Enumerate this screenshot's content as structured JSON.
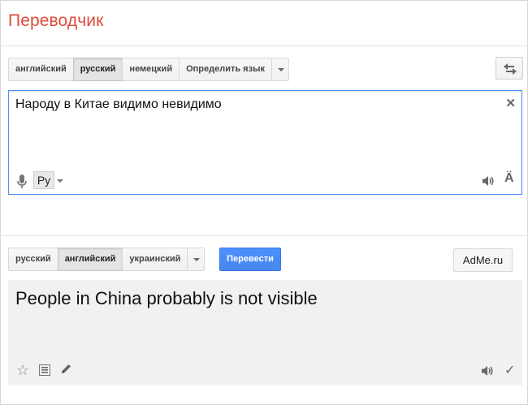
{
  "app": {
    "title": "Переводчик"
  },
  "source": {
    "languages": [
      {
        "label": "английский",
        "active": false
      },
      {
        "label": "русский",
        "active": true
      },
      {
        "label": "немецкий",
        "active": false
      },
      {
        "label": "Определить язык",
        "active": false
      }
    ],
    "text": "Народу в Китае видимо невидимо",
    "input_tool": "Ру",
    "icons": [
      "microphone-icon",
      "clear-icon",
      "speaker-icon",
      "virtual-keyboard-icon"
    ],
    "keyboard_glyph": "Ä",
    "clear_glyph": "✕"
  },
  "target": {
    "languages": [
      {
        "label": "русский",
        "active": false
      },
      {
        "label": "английский",
        "active": true
      },
      {
        "label": "украинский",
        "active": false
      }
    ],
    "translate_label": "Перевести",
    "adme_label": "AdMe.ru",
    "text": "People in China probably is not visible",
    "icons": [
      "star-icon",
      "list-icon",
      "pencil-icon",
      "speaker-icon",
      "check-icon"
    ],
    "star_glyph": "☆",
    "check_glyph": "✓"
  },
  "colors": {
    "title": "#dd4b39",
    "accent": "#4d90fe"
  }
}
